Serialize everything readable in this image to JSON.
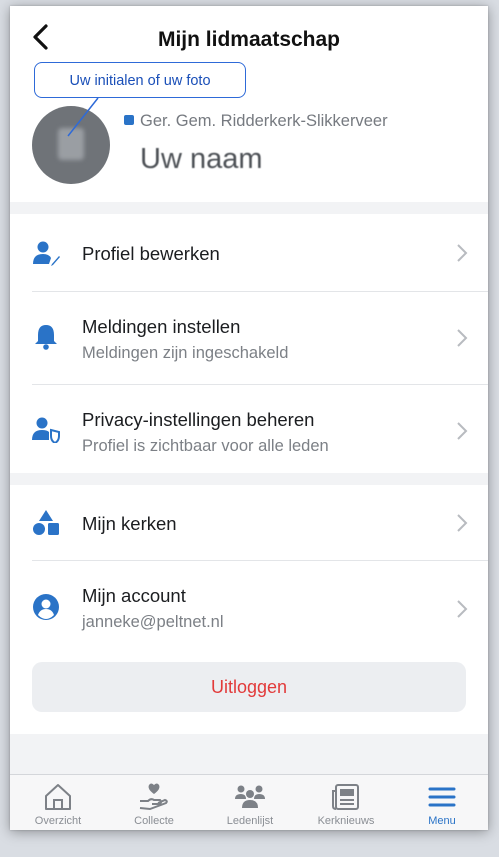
{
  "header": {
    "title": "Mijn lidmaatschap",
    "callout": "Uw initialen of uw foto",
    "church": "Ger. Gem. Ridderkerk-Slikkerveer",
    "name": "Uw naam"
  },
  "menu": {
    "items": [
      {
        "label": "Profiel bewerken",
        "icon": "edit-profile-icon"
      },
      {
        "label": "Meldingen instellen",
        "sub": "Meldingen zijn ingeschakeld",
        "icon": "bell-icon"
      },
      {
        "label": "Privacy-instellingen beheren",
        "sub": "Profiel is zichtbaar voor alle leden",
        "icon": "privacy-icon"
      },
      {
        "label": "Mijn kerken",
        "icon": "churches-icon"
      },
      {
        "label": "Mijn account",
        "sub": "janneke@peltnet.nl",
        "icon": "account-icon"
      }
    ],
    "logout": "Uitloggen"
  },
  "tabs": [
    {
      "label": "Overzicht",
      "icon": "home-icon"
    },
    {
      "label": "Collecte",
      "icon": "donate-icon"
    },
    {
      "label": "Ledenlijst",
      "icon": "members-icon"
    },
    {
      "label": "Kerknieuws",
      "icon": "news-icon"
    },
    {
      "label": "Menu",
      "icon": "menu-icon",
      "active": true
    }
  ],
  "colors": {
    "accent": "#2a73c7",
    "logout": "#e23a3a",
    "callout": "#2e6ad8"
  }
}
